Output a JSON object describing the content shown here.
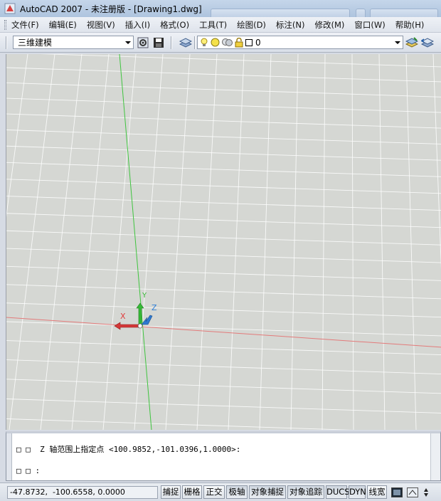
{
  "window": {
    "title": "AutoCAD 2007 - 未注册版 - [Drawing1.dwg]"
  },
  "menu": {
    "items": [
      "文件(F)",
      "编辑(E)",
      "视图(V)",
      "插入(I)",
      "格式(O)",
      "工具(T)",
      "绘图(D)",
      "标注(N)",
      "修改(M)",
      "窗口(W)",
      "帮助(H)"
    ]
  },
  "toolbar": {
    "workspace_value": "三维建模",
    "layer_value": "0"
  },
  "viewport": {
    "ucs_labels": {
      "x": "X",
      "y": "Y",
      "z": "Z"
    },
    "colors": {
      "x_axis": "#e03c3c",
      "y_axis": "#3cc43c",
      "z_axis": "#2f7fd6",
      "grid": "#ffffff",
      "background": "#d5d7d3"
    }
  },
  "command_line": {
    "line1": "□ □  Z 轴范围上指定点 <100.9852,-101.0396,1.0000>:",
    "line2": "□ □ :"
  },
  "statusbar": {
    "coordinates": "-47.8732,  -100.6558, 0.0000",
    "buttons": [
      "捕捉",
      "栅格",
      "正交",
      "极轴",
      "对象捕捉",
      "对象追踪",
      "DUCS",
      "DYN",
      "线宽"
    ]
  }
}
